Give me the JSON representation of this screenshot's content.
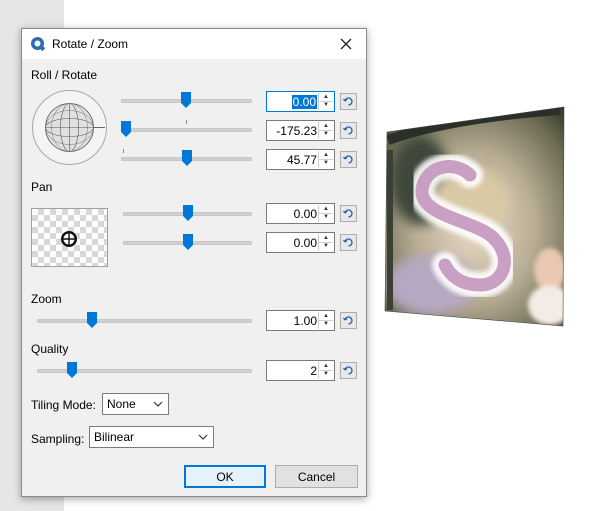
{
  "dialog": {
    "title": "Rotate / Zoom",
    "icon": "app-logo-icon",
    "close_icon": "close-icon"
  },
  "roll_rotate": {
    "label": "Roll / Rotate",
    "angle": {
      "value": "0.00",
      "slider_fraction": 0.5
    },
    "roll": {
      "value": "-175.23",
      "slider_fraction": 0.013
    },
    "tilt": {
      "value": "45.77",
      "slider_fraction": 0.5
    }
  },
  "pan": {
    "label": "Pan",
    "x": {
      "value": "0.00",
      "slider_fraction": 0.5
    },
    "y": {
      "value": "0.00",
      "slider_fraction": 0.5
    }
  },
  "zoom": {
    "label": "Zoom",
    "value": "1.00",
    "slider_fraction": 0.25
  },
  "quality": {
    "label": "Quality",
    "value": "2",
    "slider_fraction": 0.16
  },
  "tiling": {
    "label": "Tiling Mode:",
    "selected": "None"
  },
  "sampling": {
    "label": "Sampling:",
    "selected": "Bilinear"
  },
  "buttons": {
    "ok": "OK",
    "cancel": "Cancel"
  },
  "colors": {
    "accent": "#0078d7",
    "preview_lettering": "#c9a0c4"
  },
  "icons": {
    "reset": "reset-arrow-icon",
    "spin_up": "spin-up-icon",
    "spin_down": "spin-down-icon",
    "dropdown": "chevron-down-icon",
    "pan_center": "move-crosshair-icon",
    "globe": "rotation-globe-icon"
  }
}
